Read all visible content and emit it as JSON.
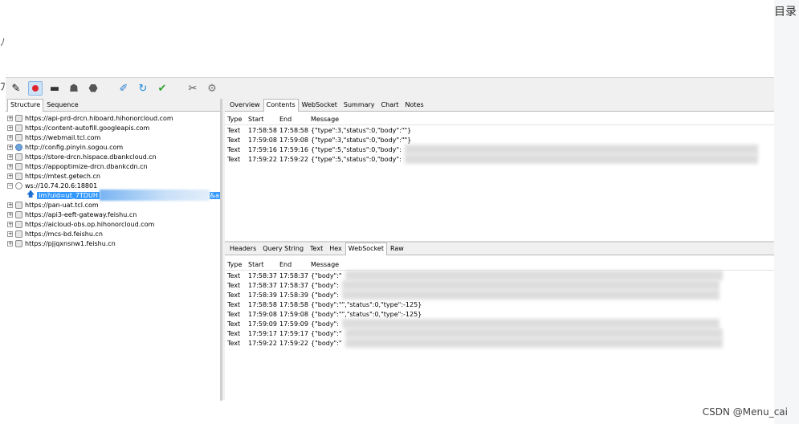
{
  "page": {
    "toc_title": "目录",
    "left_crop_1": "ﾉ",
    "left_crop_2": "ﾌ",
    "csdn_label": "CSDN @Menu_cai"
  },
  "toolbar": {
    "icons": [
      "comment-icon",
      "record-icon",
      "throttle-icon",
      "turtle-icon",
      "stop-icon",
      "compose-icon",
      "repeat-icon",
      "validate-icon",
      "tools-icon",
      "settings-icon"
    ]
  },
  "left_tabs": [
    "Structure",
    "Sequence"
  ],
  "tree": [
    {
      "label": "https://api-prd-drcn.hiboard.hihonorcloud.com",
      "icon": "host"
    },
    {
      "label": "https://content-autofill.googleapis.com",
      "icon": "host"
    },
    {
      "label": "https://webmail.tcl.com",
      "icon": "host"
    },
    {
      "label": "http://config.pinyin.sogou.com",
      "icon": "globe"
    },
    {
      "label": "https://store-drcn.hispace.dbankcloud.cn",
      "icon": "host"
    },
    {
      "label": "https://appoptimize-drcn.dbankcdn.cn",
      "icon": "host"
    },
    {
      "label": "https://mtest.getech.cn",
      "icon": "host"
    },
    {
      "label": "ws://10.74.20.6:18801",
      "icon": "ws"
    },
    {
      "label": "https://pan-uat.tcl.com",
      "icon": "host"
    },
    {
      "label": "https://api3-eeft-gateway.feishu.cn",
      "icon": "host"
    },
    {
      "label": "https://aicloud-obs.op.hihonorcloud.com",
      "icon": "host"
    },
    {
      "label": "https://mcs-bd.feishu.cn",
      "icon": "host"
    },
    {
      "label": "https://pjjqxnsnw1.feishu.cn",
      "icon": "host"
    }
  ],
  "ws_child": {
    "label": "im?uid=ut_7TDUH",
    "trail": "&a"
  },
  "upper_tabs": [
    "Overview",
    "Contents",
    "WebSocket",
    "Summary",
    "Chart",
    "Notes"
  ],
  "upper_active": "Contents",
  "lower_tabs": [
    "Headers",
    "Query String",
    "Text",
    "Hex",
    "WebSocket",
    "Raw"
  ],
  "lower_active": "WebSocket",
  "columns": {
    "type": "Type",
    "start": "Start",
    "end": "End",
    "message": "Message"
  },
  "upper_rows": [
    {
      "type": "Text",
      "start": "17:58:58",
      "end": "17:58:58",
      "message": "{\"type\":3,\"status\":0,\"body\":\"\"}"
    },
    {
      "type": "Text",
      "start": "17:59:08",
      "end": "17:59:08",
      "message": "{\"type\":3,\"status\":0,\"body\":\"\"}"
    },
    {
      "type": "Text",
      "start": "17:59:16",
      "end": "17:59:16",
      "message": "{\"type\":5,\"status\":0,\"body\":"
    },
    {
      "type": "Text",
      "start": "17:59:22",
      "end": "17:59:22",
      "message": "{\"type\":5,\"status\":0,\"body\":"
    }
  ],
  "lower_rows": [
    {
      "type": "Text",
      "start": "17:58:37",
      "end": "17:58:37",
      "message": "{\"body\":\""
    },
    {
      "type": "Text",
      "start": "17:58:37",
      "end": "17:58:37",
      "message": "{\"body\":"
    },
    {
      "type": "Text",
      "start": "17:58:39",
      "end": "17:58:39",
      "message": "{\"body\":"
    },
    {
      "type": "Text",
      "start": "17:58:58",
      "end": "17:58:58",
      "message": "{\"body\":\"\",\"status\":0,\"type\":-125}"
    },
    {
      "type": "Text",
      "start": "17:59:08",
      "end": "17:59:08",
      "message": "{\"body\":\"\",\"status\":0,\"type\":-125}"
    },
    {
      "type": "Text",
      "start": "17:59:09",
      "end": "17:59:09",
      "message": "{\"body\":"
    },
    {
      "type": "Text",
      "start": "17:59:17",
      "end": "17:59:17",
      "message": "{\"body\":\""
    },
    {
      "type": "Text",
      "start": "17:59:22",
      "end": "17:59:22",
      "message": "{\"body\":\""
    }
  ]
}
